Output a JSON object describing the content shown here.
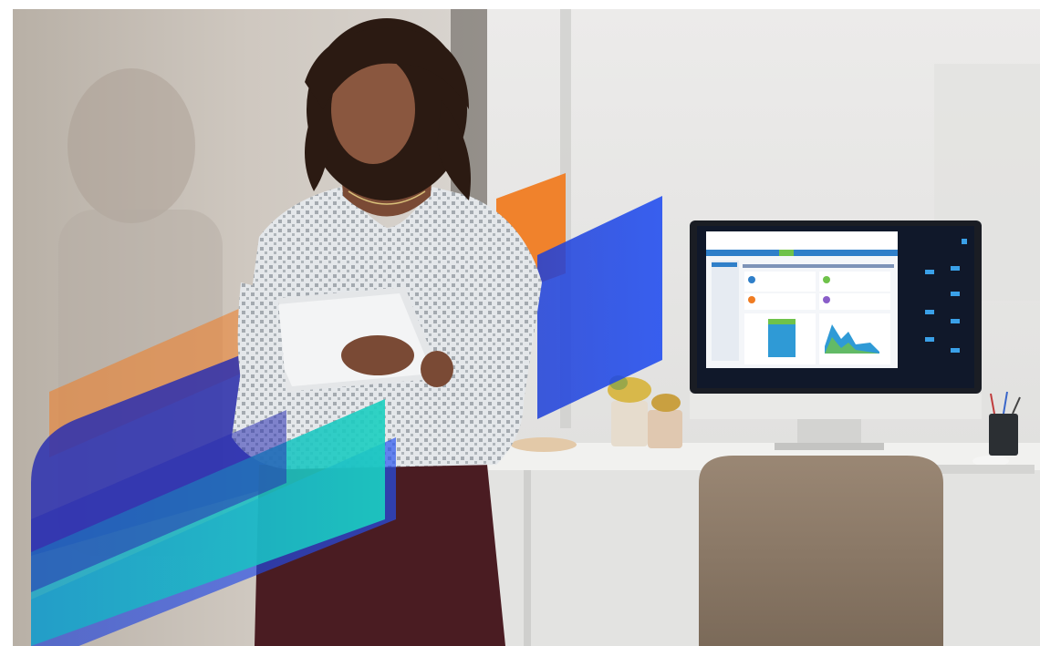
{
  "scene": {
    "description_free": true,
    "colors": {
      "wall_left": "#c7bfb6",
      "wall_right": "#e6e6e4",
      "shirt": "#d9dde0",
      "pants": "#4a1c22",
      "skin": "#7a4a35",
      "hair": "#2b1a12",
      "chair": "#8a7764",
      "desk": "#efefed",
      "monitor_frame": "#1a1d24",
      "stripe_orange": "#f07c22",
      "stripe_blue": "#1f3fe0",
      "stripe_dark_blue": "#2a2fb0",
      "stripe_teal": "#19c4c0",
      "plant_yellow": "#d8b84a"
    },
    "icons": [
      "monitor-icon",
      "tablet-icon",
      "chair-icon",
      "plant-icon",
      "pen-cup-icon"
    ]
  },
  "monitor_screen": {
    "app_name": "",
    "dashboard_title": "",
    "panel_left_title": "",
    "panel_right_title": ""
  }
}
